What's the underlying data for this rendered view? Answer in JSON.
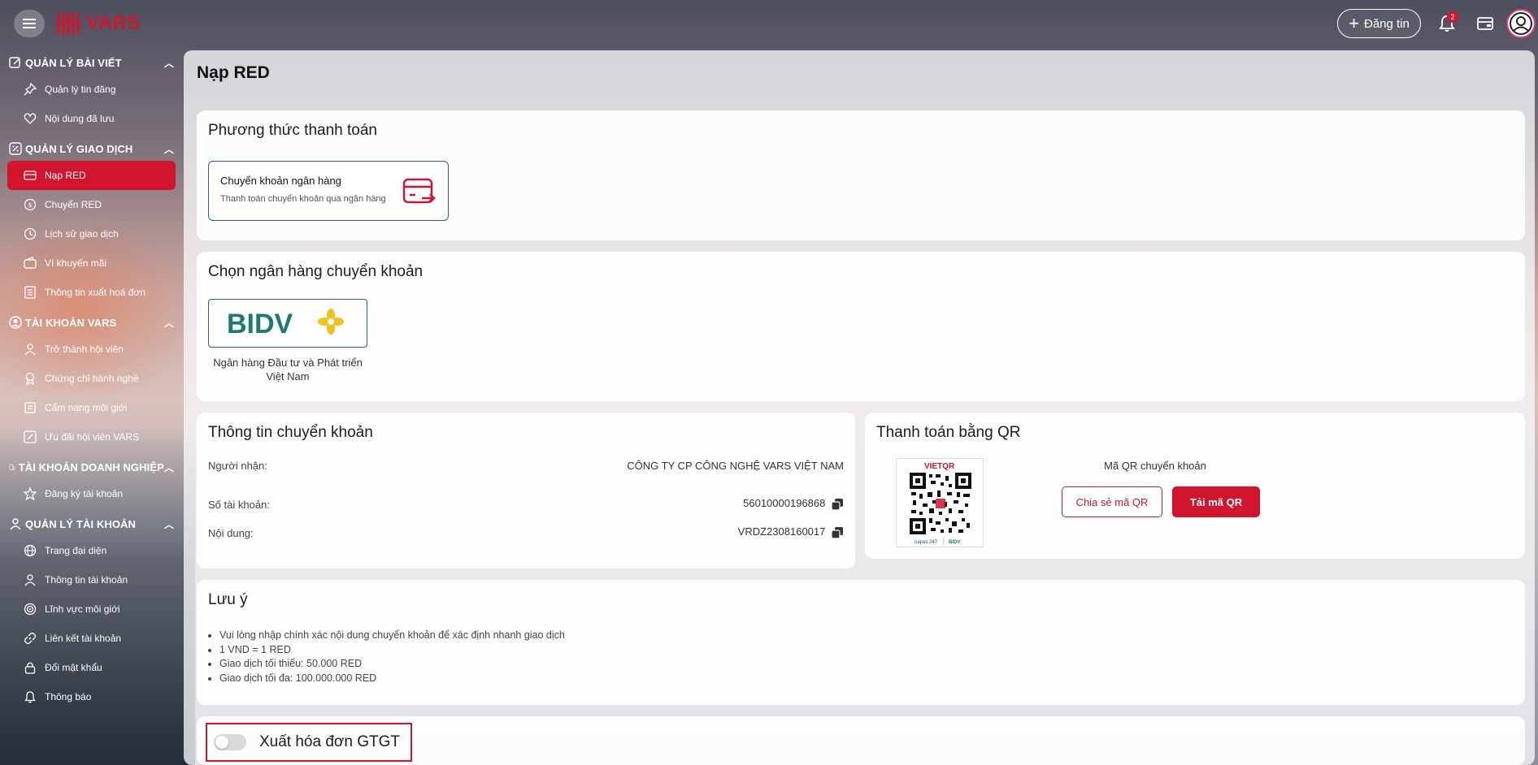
{
  "header": {
    "logo_text": "VARS",
    "post_button": "Đăng tin",
    "notification_count": "2"
  },
  "sidebar": {
    "sections": [
      {
        "title": "QUẢN LÝ BÀI VIẾT",
        "items": [
          "Quản lý tin đăng",
          "Nội dung đã lưu"
        ]
      },
      {
        "title": "QUẢN LÝ GIAO DỊCH",
        "items": [
          "Nạp RED",
          "Chuyển RED",
          "Lịch sử giao dịch",
          "Ví khuyến mãi",
          "Thông tin xuất hoá đơn"
        ]
      },
      {
        "title": "TÀI KHOẢN VARS",
        "items": [
          "Trở thành hội viên",
          "Chứng chỉ hành nghề",
          "Cẩm nang môi giới",
          "Ưu đãi hội viên VARS"
        ]
      },
      {
        "title": "TÀI KHOẢN DOANH NGHIỆP",
        "items": [
          "Đăng ký tài khoản"
        ]
      },
      {
        "title": "QUẢN LÝ TÀI KHOẢN",
        "items": [
          "Trang đại diện",
          "Thông tin tài khoản",
          "Lĩnh vực môi giới",
          "Liên kết tài khoản",
          "Đổi mật khẩu",
          "Thông báo"
        ]
      }
    ],
    "active_item": "Nạp RED"
  },
  "main": {
    "page_title": "Nạp RED",
    "payment_method": {
      "title": "Phương thức thanh toán",
      "option_title": "Chuyển khoản ngân hàng",
      "option_desc": "Thanh toán chuyển khoản qua ngân hàng"
    },
    "bank_select": {
      "title": "Chọn ngân hàng chuyển khoản",
      "bank_logo_text": "BIDV",
      "bank_name": "Ngân hàng Đầu tư và Phát triển Việt Nam"
    },
    "transfer_info": {
      "title": "Thông tin chuyển khoản",
      "recipient_label": "Người nhận:",
      "recipient_value": "CÔNG TY CP CÔNG NGHỆ VARS VIỆT NAM",
      "account_label": "Số tài khoản:",
      "account_value": "56010000196868",
      "content_label": "Nội dung:",
      "content_value": "VRDZ2308160017"
    },
    "qr_payment": {
      "title": "Thanh toán bằng QR",
      "caption": "Mã QR chuyển khoản",
      "share_button": "Chia sẻ mã QR",
      "download_button": "Tải mã QR",
      "qr_brand": "VIETQR",
      "qr_footer_left": "napas 247",
      "qr_footer_right": "BIDV"
    },
    "notes": {
      "title": "Lưu ý",
      "items": [
        "Vui lòng nhập chính xác nội dung chuyển khoản để xác định nhanh giao dịch",
        "1 VND = 1 RED",
        "Giao dịch tối thiểu: 50.000 RED",
        "Giao dịch tối đa: 100.000.000 RED"
      ]
    },
    "vat": {
      "label": "Xuất hóa đơn GTGT",
      "enabled": false
    }
  },
  "colors": {
    "brand_red": "#d0152d",
    "bank_border": "#2e5aa8",
    "bidv_green": "#1a7a74",
    "bidv_gold": "#f2c21b"
  }
}
